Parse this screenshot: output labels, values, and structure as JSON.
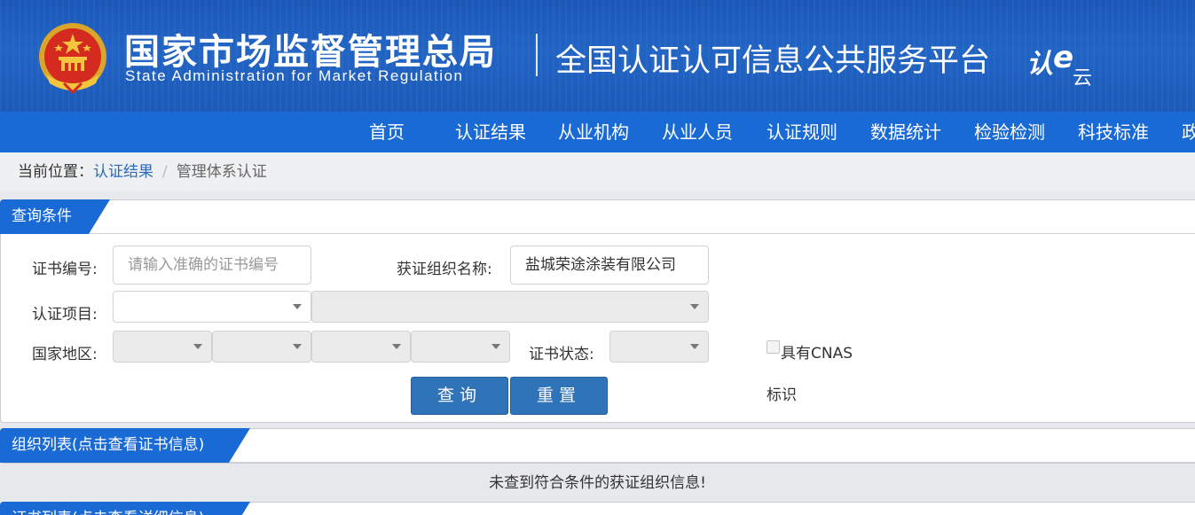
{
  "header": {
    "agency_cn": "国家市场监督管理总局",
    "agency_en": "State Administration for Market Regulation",
    "platform_title": "全国认证认可信息公共服务平台",
    "logo_text": "认e云",
    "logo_text_1": "认",
    "logo_text_2": "e",
    "logo_text_3": "云"
  },
  "nav": {
    "items": [
      "首页",
      "认证结果",
      "从业机构",
      "从业人员",
      "认证规则",
      "数据统计",
      "检验检测",
      "科技标准",
      "政"
    ]
  },
  "breadcrumb": {
    "label": "当前位置：",
    "link": "认证结果",
    "separator": "/",
    "current": "管理体系认证"
  },
  "query_panel": {
    "title": "查询条件",
    "cert_no_label": "证书编号:",
    "cert_no_placeholder": "请输入准确的证书编号",
    "org_name_label": "获证组织名称:",
    "org_name_value": "盐城荣途涂装有限公司",
    "project_label": "认证项目:",
    "region_label": "国家地区:",
    "status_label": "证书状态:",
    "cnas_label_line1": "具有CNAS",
    "cnas_label_line2": "标识",
    "cnas_checked": false,
    "search_button": "查询",
    "reset_button": "重置"
  },
  "org_list_panel": {
    "title": "组织列表(点击查看证书信息)",
    "empty_message": "未查到符合条件的获证组织信息!"
  },
  "cert_list_panel": {
    "title": "证书列表(点击查看详细信息)"
  },
  "colors": {
    "banner_blue": "#1b57b8",
    "nav_blue": "#1a6ad6",
    "button_blue": "#2f73b8",
    "link_blue": "#2a6bbd"
  }
}
